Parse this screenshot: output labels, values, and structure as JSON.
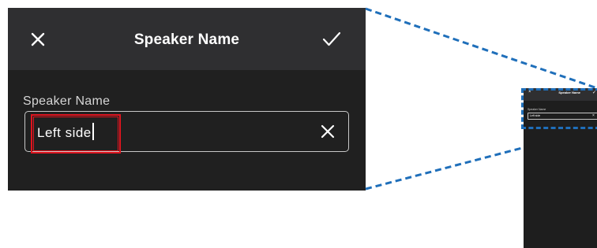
{
  "dialog": {
    "title": "Speaker Name",
    "close_icon": "close-icon",
    "confirm_icon": "checkmark-icon"
  },
  "field": {
    "label": "Speaker Name",
    "value": "Left side",
    "clear_icon": "clear-icon"
  },
  "mini": {
    "title": "Speaker Name",
    "label": "Speaker Name",
    "value": "Left side",
    "close_glyph": "×",
    "check_glyph": "✓",
    "clear_glyph": "×"
  },
  "colors": {
    "header_bg": "#2f2f31",
    "body_bg": "#202020",
    "highlight": "#e0141e",
    "callout_dash": "#1f6fba",
    "text": "#ffffff"
  }
}
